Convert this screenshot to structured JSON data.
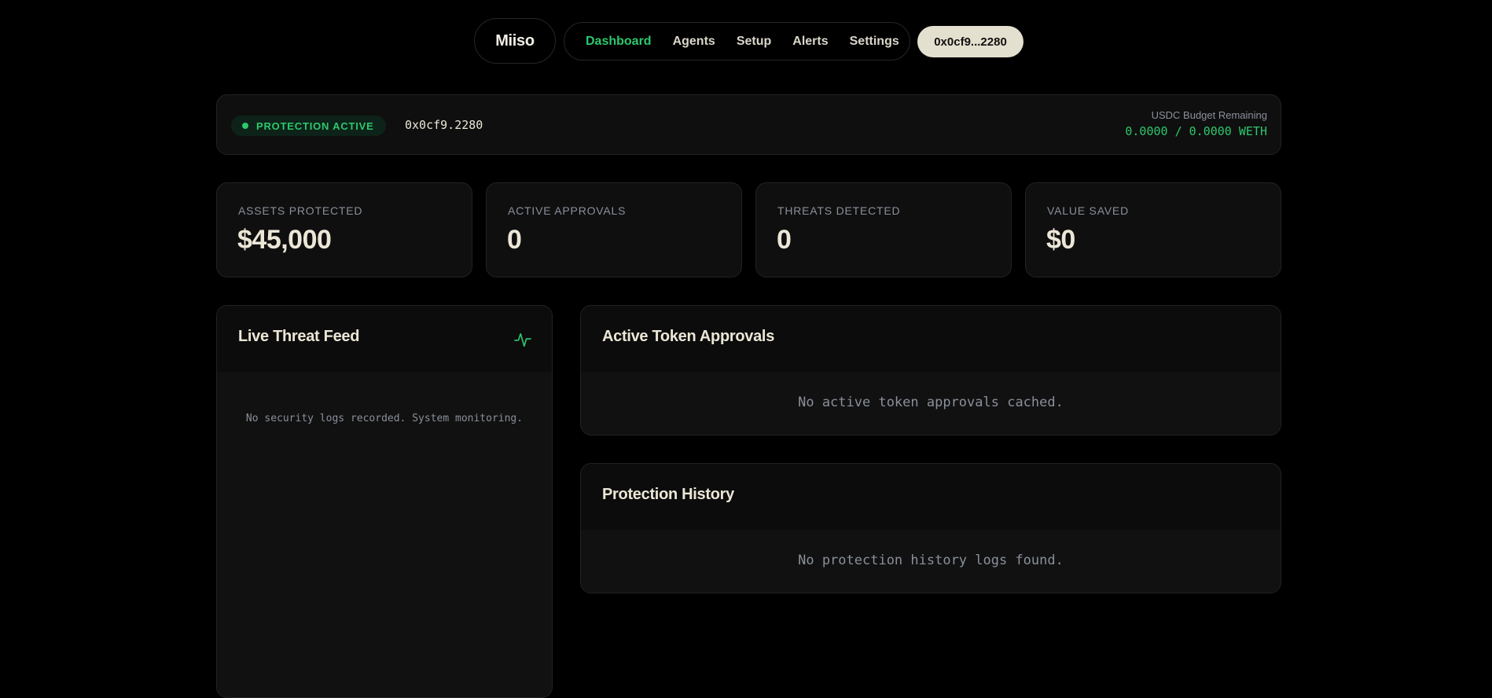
{
  "nav": {
    "logo": "Miiso",
    "links": [
      "Dashboard",
      "Agents",
      "Setup",
      "Alerts",
      "Settings"
    ],
    "active_link": "Dashboard",
    "wallet": "0x0cf9...2280"
  },
  "status": {
    "badge": "PROTECTION ACTIVE",
    "address": "0x0cf9.2280",
    "budget_label": "USDC Budget Remaining",
    "budget_value": "0.0000 / 0.0000 WETH"
  },
  "stats": [
    {
      "label": "ASSETS PROTECTED",
      "value": "$45,000"
    },
    {
      "label": "ACTIVE APPROVALS",
      "value": "0"
    },
    {
      "label": "THREATS DETECTED",
      "value": "0"
    },
    {
      "label": "VALUE SAVED",
      "value": "$0"
    }
  ],
  "threat_feed": {
    "title": "Live Threat Feed",
    "icon": "activity-pulse-icon",
    "empty": "No security logs recorded. System monitoring."
  },
  "approvals": {
    "title": "Active Token Approvals",
    "empty": "No active token approvals cached."
  },
  "history": {
    "title": "Protection History",
    "empty": "No protection history logs found."
  },
  "colors": {
    "accent": "#2dc76d",
    "background": "#000000",
    "card": "#0f0f0f",
    "text": "#ebe6d6",
    "muted": "#8a8f9a",
    "wallet_pill": "#e4e0cf"
  }
}
